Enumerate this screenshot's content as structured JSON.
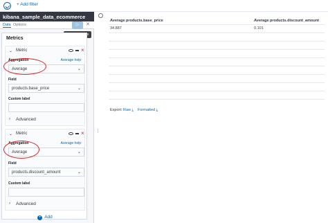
{
  "topbar": {
    "add_filter": "+ Add filter"
  },
  "sidebar": {
    "index_pattern": "kibana_sample_data_ecommerce",
    "tabs": [
      "Data",
      "Options"
    ],
    "apply_icon": "play-icon",
    "tooltip": "Apply changes",
    "panel_title": "Metrics",
    "metrics": [
      {
        "title": "Metric",
        "aggregation_label": "Aggregation",
        "help_link": "Average help",
        "aggregation_value": "Average",
        "field_label": "Field",
        "field_value": "products.base_price",
        "custom_label": "Custom label",
        "advanced": "Advanced"
      },
      {
        "title": "Metric",
        "aggregation_label": "Aggregation",
        "help_link": "Average help",
        "aggregation_value": "Average",
        "field_label": "Field",
        "field_value": "products.discount_amount",
        "custom_label": "Custom label",
        "advanced": "Advanced"
      }
    ],
    "add_label": "Add"
  },
  "table": {
    "headers": [
      "Average products.base_price",
      "Average products.discount_amount"
    ],
    "rows": [
      [
        "34.887",
        "0.101"
      ]
    ],
    "export": {
      "label": "Export:",
      "raw": "Raw",
      "formatted": "Formatted"
    }
  },
  "colors": {
    "accent": "#006bb4",
    "annotation_circle": "#d6262a",
    "header_bg": "#343741"
  }
}
